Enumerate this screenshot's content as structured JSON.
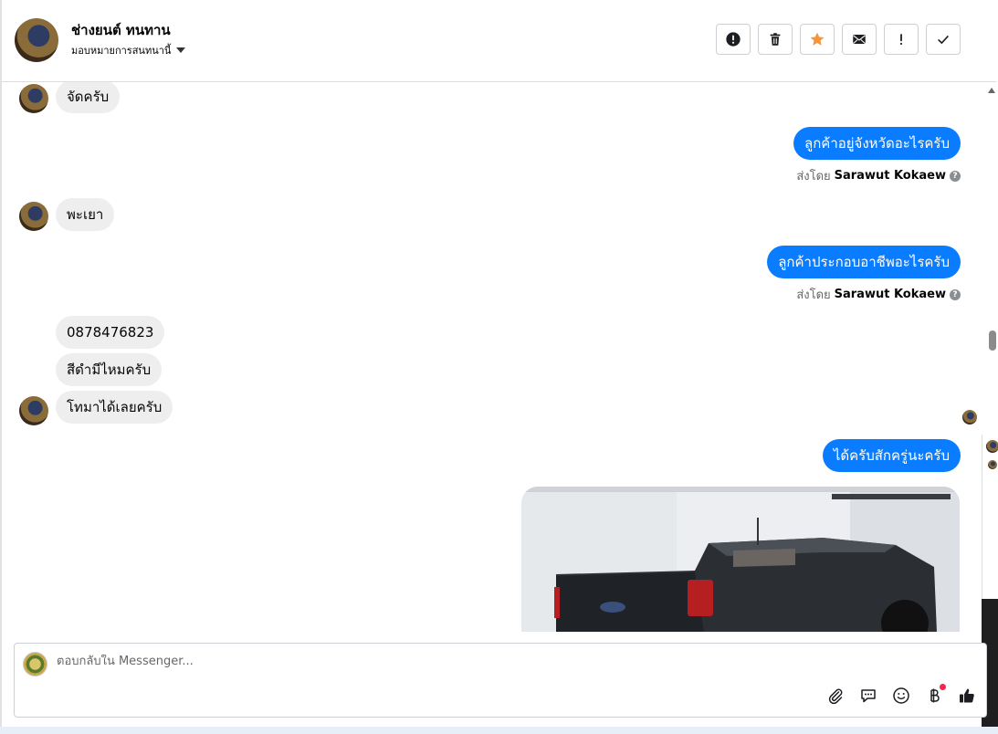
{
  "header": {
    "name": "ช่างยนต์ ทนทาน",
    "assign_label": "มอบหมายการสนทนานี้"
  },
  "toolbar": {
    "buttons": [
      {
        "name": "mark-spam-button",
        "icon": "alert-circle-icon"
      },
      {
        "name": "delete-button",
        "icon": "trash-icon"
      },
      {
        "name": "star-button",
        "icon": "star-icon"
      },
      {
        "name": "mark-unread-button",
        "icon": "envelope-icon"
      },
      {
        "name": "follow-up-button",
        "icon": "exclamation-icon"
      },
      {
        "name": "mark-done-button",
        "icon": "check-icon"
      }
    ],
    "accent_star": "#f5943b"
  },
  "messages": {
    "m1": "จัดครับ",
    "m2": "ลูกค้าอยู่จังหวัดอะไรครับ",
    "m3": "พะเยา",
    "m4": "ลูกค้าประกอบอาชีพอะไรครับ",
    "m5": "0878476823",
    "m6": "สีดำมีไหมครับ",
    "m7": "โทมาได้เลยครับ",
    "m8": "ได้ครับสักครู่นะครับ",
    "sent_by_label": "ส่งโดย",
    "sender": "Sarawut Kokaew",
    "help_glyph": "?"
  },
  "composer": {
    "placeholder": "ตอบกลับใน Messenger..."
  },
  "colors": {
    "outgoing_bubble": "#0a7cff",
    "incoming_bubble": "#eeeeee",
    "notification_dot": "#f02849"
  }
}
